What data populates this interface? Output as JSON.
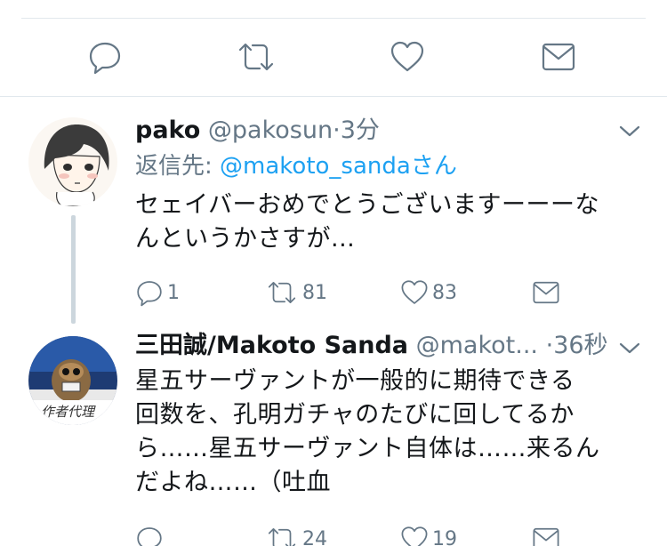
{
  "focused_actions": {
    "reply_icon": "reply-icon",
    "retweet_icon": "retweet-icon",
    "like_icon": "heart-icon",
    "dm_icon": "envelope-icon"
  },
  "tweets": [
    {
      "name": "pako",
      "handle": "@pakosun",
      "separator": "·",
      "time": "3分",
      "reply_label": "返信先: ",
      "reply_handle": "@makoto_sanda",
      "reply_suffix": "さん",
      "lines": [
        "セェイバーおめでとうございますーーーな",
        "んというかさすが..."
      ],
      "replies": "1",
      "retweets": "81",
      "likes": "83"
    },
    {
      "name": "三田誠/Makoto Sanda",
      "handle": "@makot...",
      "separator": "·",
      "time": "36秒",
      "lines": [
        "星五サーヴァントが一般的に期待できる",
        "回数を、孔明ガチャのたびに回してるか",
        "ら……星五サーヴァント自体は……来るん",
        "だよね……（吐血"
      ],
      "replies": "",
      "retweets": "24",
      "likes": "19",
      "avatar_caption": "作者代理"
    }
  ],
  "colors": {
    "link": "#1da1f2",
    "secondary": "#657786",
    "divider": "#e1e8ed",
    "thread": "#ccd6dd"
  }
}
